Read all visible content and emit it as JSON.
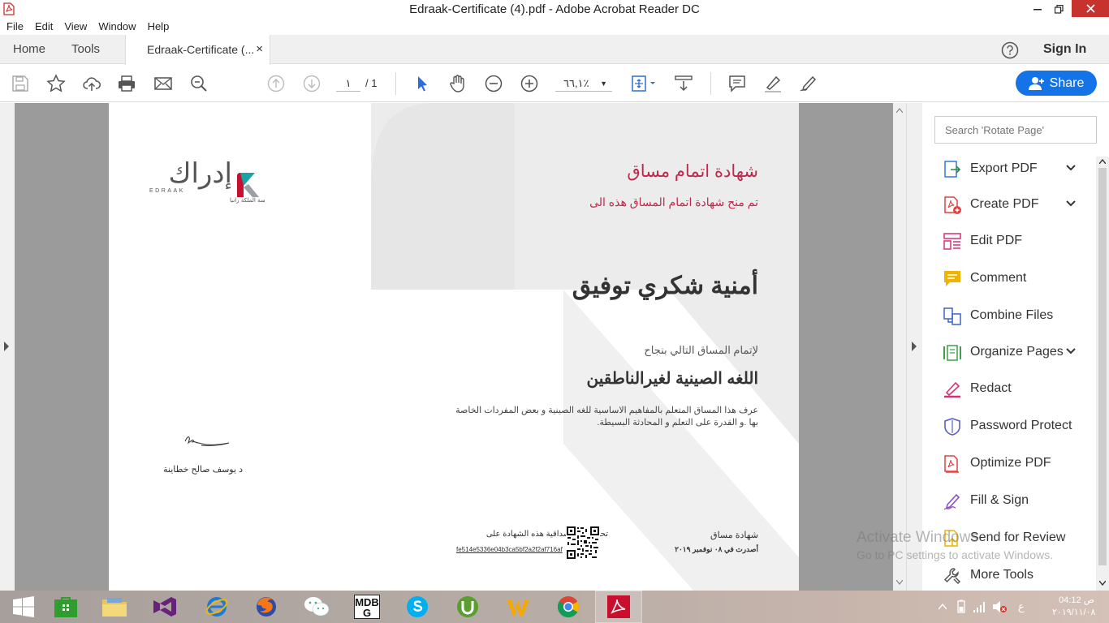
{
  "window": {
    "title": "Edraak-Certificate (4).pdf - Adobe Acrobat Reader DC"
  },
  "menu": [
    "File",
    "Edit",
    "View",
    "Window",
    "Help"
  ],
  "tabs": {
    "home": "Home",
    "tools": "Tools",
    "document": "Edraak-Certificate (...",
    "close": "×",
    "sign_in": "Sign In"
  },
  "toolbar": {
    "current_page": "١",
    "page_total": "/ 1",
    "zoom": "٦٦,١٪",
    "share_label": "Share"
  },
  "certificate": {
    "logo_text": "إدراك",
    "logo_latin": "EDRAAK",
    "logo_tagline": "إحدى مبادرات مؤسسة الملكة رانيا",
    "title": "شهادة اتمام مساق",
    "subtitle": "تم منح شهادة اتمام المساق هذه الى",
    "recipient": "أمنية شكري توفيق",
    "intro": "لإتمام المساق التالي بنجاح",
    "course": "اللغه الصينية لغيرالناطقين",
    "description": "عرف هذا المساق المتعلم بالمفاهيم الاساسية للغه الصينية و بعض المفردات الخاصة بها .و القدرة على التعلم و المحادثة البسيطة.",
    "signer": "د يوسف صالح خطاينة",
    "verify_text": "تحقق من مصداقية هذه الشهادة على",
    "verify_hash": "fe514e5336e04b3ca5bf2a2f2af716af",
    "type": "شهادة مساق",
    "issued": "أصدرت في ٠٨ نوفمبر ٢٠١٩"
  },
  "tools_panel": {
    "search_placeholder": "Search 'Rotate Page'",
    "items": [
      {
        "label": "Export PDF",
        "icon": "export-pdf-icon",
        "color": "#2d7be5",
        "expandable": true
      },
      {
        "label": "Create PDF",
        "icon": "create-pdf-icon",
        "color": "#e0403e",
        "expandable": true
      },
      {
        "label": "Edit PDF",
        "icon": "edit-pdf-icon",
        "color": "#d6307a",
        "expandable": false
      },
      {
        "label": "Comment",
        "icon": "comment-icon",
        "color": "#f0b400",
        "expandable": false
      },
      {
        "label": "Combine Files",
        "icon": "combine-files-icon",
        "color": "#3d63c9",
        "expandable": false
      },
      {
        "label": "Organize Pages",
        "icon": "organize-pages-icon",
        "color": "#3ea04a",
        "expandable": true
      },
      {
        "label": "Redact",
        "icon": "redact-icon",
        "color": "#d6307a",
        "expandable": false
      },
      {
        "label": "Password Protect",
        "icon": "password-protect-icon",
        "color": "#5b5fc7",
        "expandable": false
      },
      {
        "label": "Optimize PDF",
        "icon": "optimize-pdf-icon",
        "color": "#e0403e",
        "expandable": false
      },
      {
        "label": "Fill & Sign",
        "icon": "fill-sign-icon",
        "color": "#8e4fc7",
        "expandable": false
      },
      {
        "label": "Send for Review",
        "icon": "send-for-review-icon",
        "color": "#f0b400",
        "expandable": false
      },
      {
        "label": "More Tools",
        "icon": "more-tools-icon",
        "color": "#555555",
        "expandable": false
      }
    ]
  },
  "watermark": {
    "line1": "Activate Windows",
    "line2": "Go to PC settings to activate Windows."
  },
  "taskbar": {
    "apps": [
      "start",
      "store",
      "file-explorer",
      "visual-studio",
      "internet-explorer",
      "firefox",
      "wechat",
      "mdbg",
      "skype",
      "utorrent",
      "wps",
      "chrome",
      "acrobat-reader"
    ],
    "mdbg_text": "MDBG",
    "tray_lang": "ع",
    "clock_time": "04:12 ص",
    "clock_date": "٢٠١٩/١١/٠٨"
  }
}
